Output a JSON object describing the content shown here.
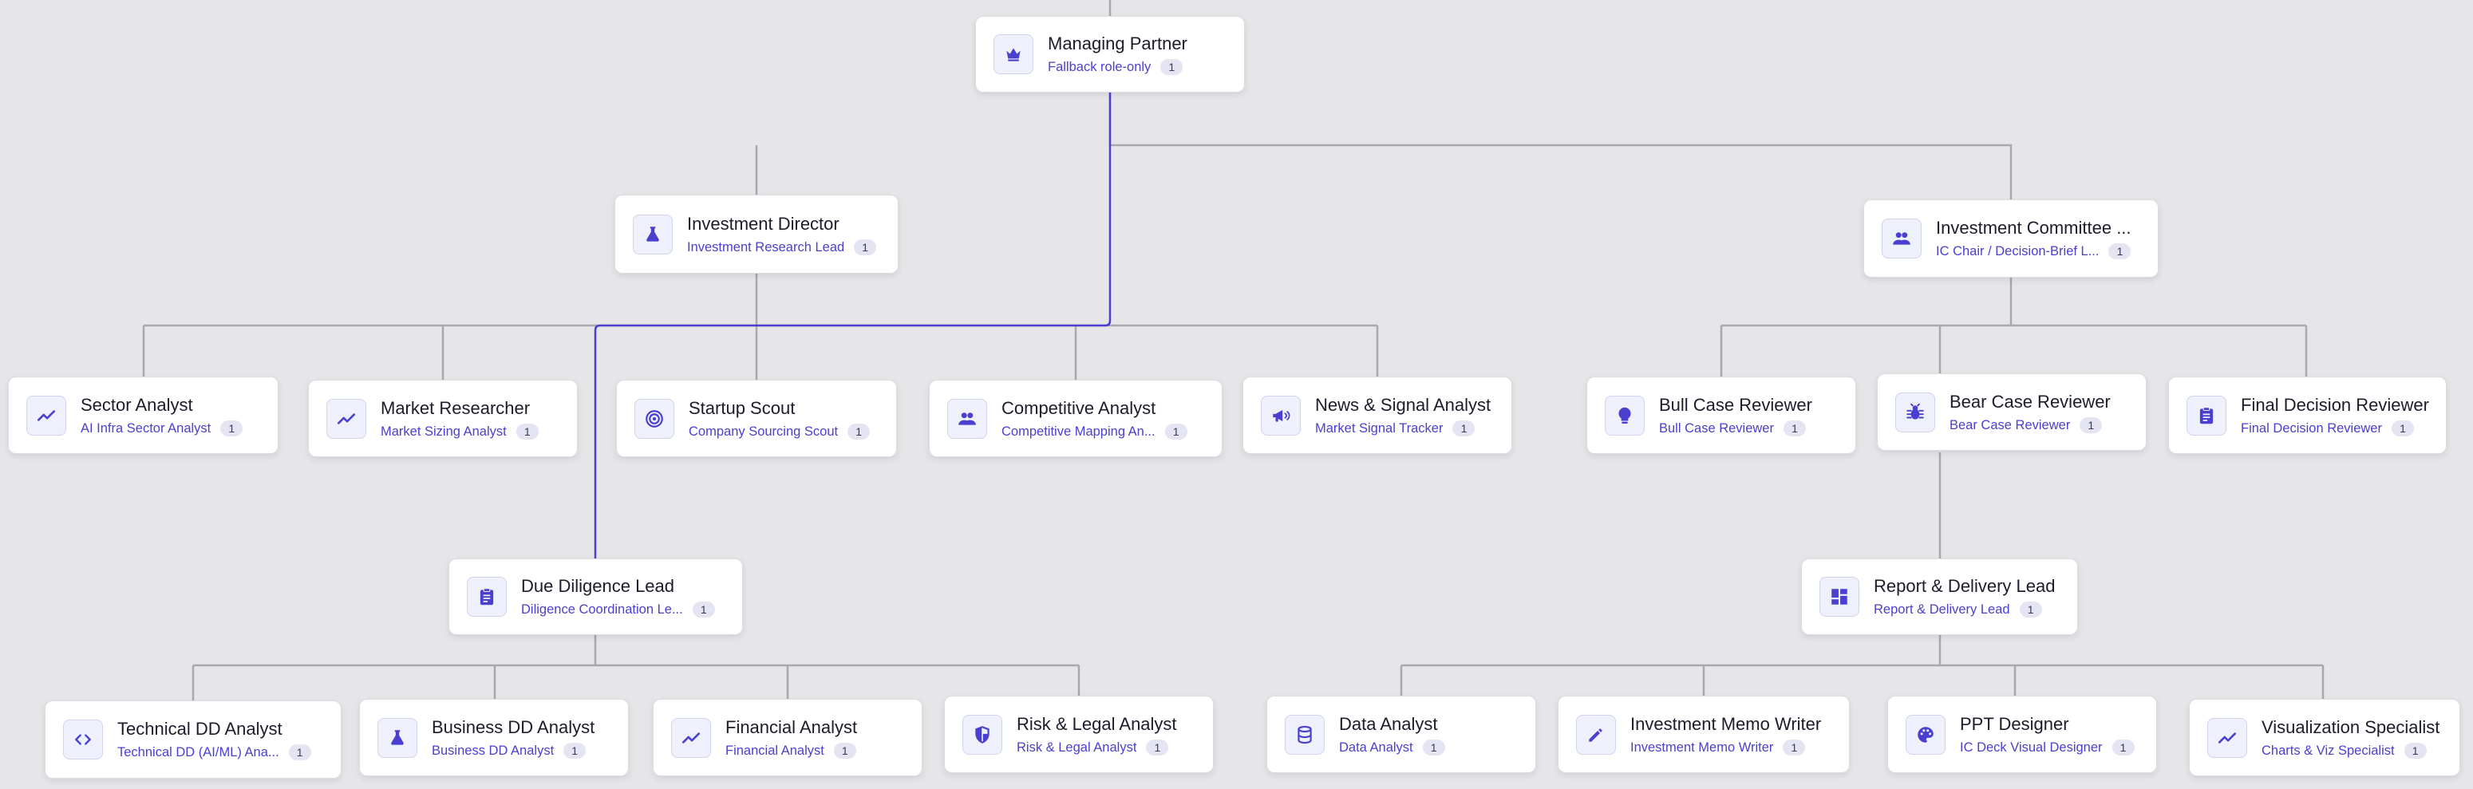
{
  "colors": {
    "background": "#e6e6e8",
    "connector": "#a9a9ad",
    "highlight_connector": "#4a3fcf",
    "accent": "#4a3fcf",
    "icon_fill": "#4a3fcf"
  },
  "nodes": [
    {
      "id": "managing-partner",
      "title": "Managing Partner",
      "subtitle": "Fallback role-only",
      "count": "1",
      "icon": "crown-icon"
    },
    {
      "id": "investment-director",
      "title": "Investment Director",
      "subtitle": "Investment Research Lead",
      "count": "1",
      "icon": "flask-icon"
    },
    {
      "id": "investment-committee",
      "title": "Investment Committee ...",
      "subtitle": "IC Chair / Decision-Brief L...",
      "count": "1",
      "icon": "group-icon"
    },
    {
      "id": "sector-analyst",
      "title": "Sector Analyst",
      "subtitle": "AI Infra Sector Analyst",
      "count": "1",
      "icon": "trend-line-icon"
    },
    {
      "id": "market-researcher",
      "title": "Market Researcher",
      "subtitle": "Market Sizing Analyst",
      "count": "1",
      "icon": "trend-line-icon"
    },
    {
      "id": "startup-scout",
      "title": "Startup Scout",
      "subtitle": "Company Sourcing Scout",
      "count": "1",
      "icon": "target-icon"
    },
    {
      "id": "competitive-analyst",
      "title": "Competitive Analyst",
      "subtitle": "Competitive Mapping An...",
      "count": "1",
      "icon": "group-icon"
    },
    {
      "id": "news-signal-analyst",
      "title": "News & Signal Analyst",
      "subtitle": "Market Signal Tracker",
      "count": "1",
      "icon": "megaphone-icon"
    },
    {
      "id": "bull-case-reviewer",
      "title": "Bull Case Reviewer",
      "subtitle": "Bull Case Reviewer",
      "count": "1",
      "icon": "lightbulb-icon"
    },
    {
      "id": "bear-case-reviewer",
      "title": "Bear Case Reviewer",
      "subtitle": "Bear Case Reviewer",
      "count": "1",
      "icon": "bug-icon"
    },
    {
      "id": "final-decision-reviewer",
      "title": "Final Decision Reviewer",
      "subtitle": "Final Decision Reviewer",
      "count": "1",
      "icon": "clipboard-icon"
    },
    {
      "id": "due-diligence-lead",
      "title": "Due Diligence Lead",
      "subtitle": "Diligence Coordination Le...",
      "count": "1",
      "icon": "clipboard-icon"
    },
    {
      "id": "report-delivery-lead",
      "title": "Report & Delivery Lead",
      "subtitle": "Report & Delivery Lead",
      "count": "1",
      "icon": "dashboard-icon"
    },
    {
      "id": "technical-dd-analyst",
      "title": "Technical DD Analyst",
      "subtitle": "Technical DD (AI/ML) Ana...",
      "count": "1",
      "icon": "code-icon"
    },
    {
      "id": "business-dd-analyst",
      "title": "Business DD Analyst",
      "subtitle": "Business DD Analyst",
      "count": "1",
      "icon": "flask-icon"
    },
    {
      "id": "financial-analyst",
      "title": "Financial Analyst",
      "subtitle": "Financial Analyst",
      "count": "1",
      "icon": "trend-line-icon"
    },
    {
      "id": "risk-legal-analyst",
      "title": "Risk & Legal Analyst",
      "subtitle": "Risk & Legal Analyst",
      "count": "1",
      "icon": "shield-icon"
    },
    {
      "id": "data-analyst",
      "title": "Data Analyst",
      "subtitle": "Data Analyst",
      "count": "1",
      "icon": "database-icon"
    },
    {
      "id": "investment-memo-writer",
      "title": "Investment Memo Writer",
      "subtitle": "Investment Memo Writer",
      "count": "1",
      "icon": "pencil-icon"
    },
    {
      "id": "ppt-designer",
      "title": "PPT Designer",
      "subtitle": "IC Deck Visual Designer",
      "count": "1",
      "icon": "palette-icon"
    },
    {
      "id": "visualization-specialist",
      "title": "Visualization Specialist",
      "subtitle": "Charts & Viz Specialist",
      "count": "1",
      "icon": "trend-line-icon"
    }
  ]
}
